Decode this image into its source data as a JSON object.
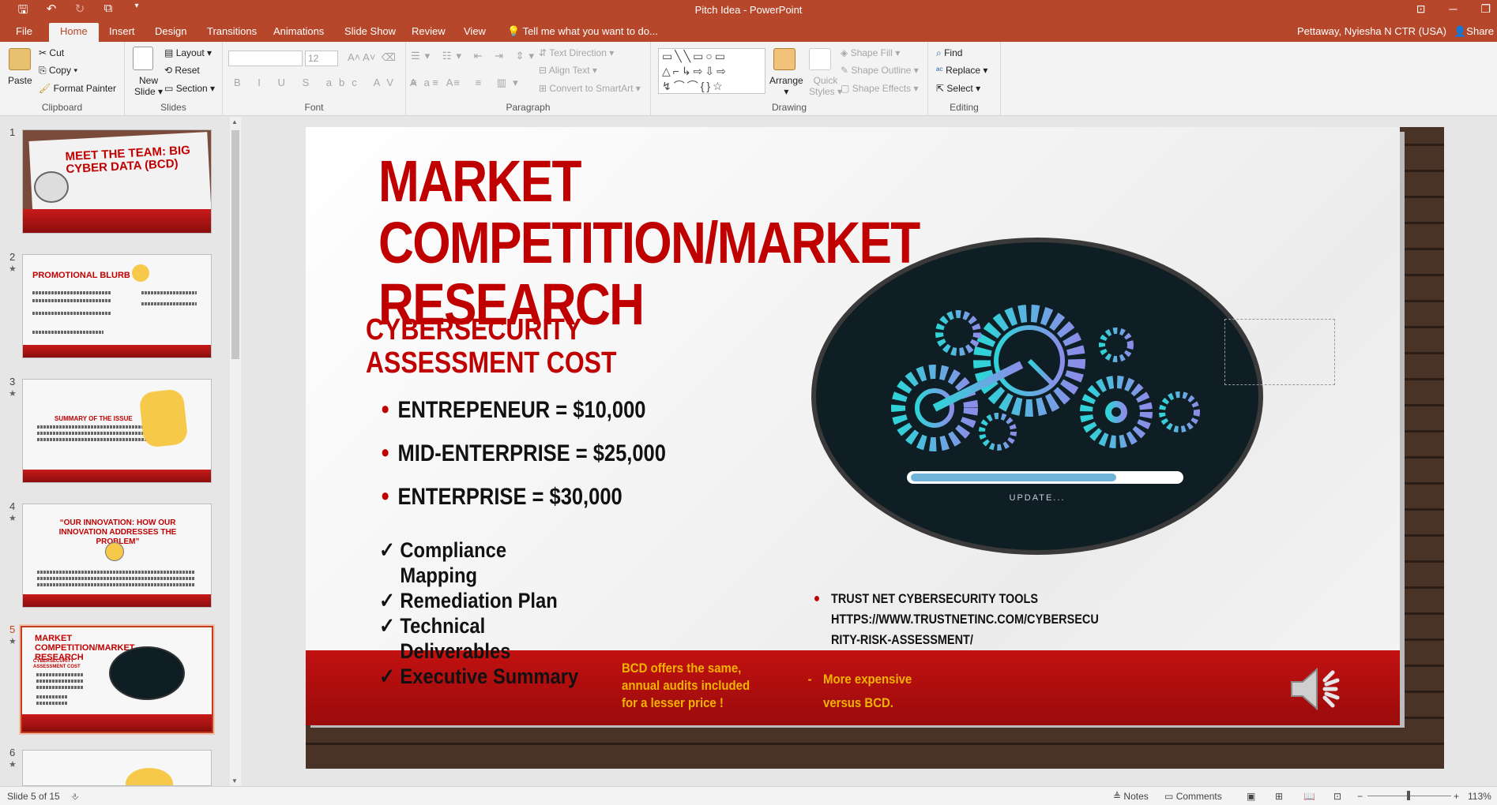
{
  "app": {
    "window_title": "Pitch Idea - PowerPoint",
    "tell_me": "Tell me what you want to do...",
    "user": "Pettaway, Nyiesha N CTR (USA)",
    "share": "Share"
  },
  "tabs": [
    "File",
    "Home",
    "Insert",
    "Design",
    "Transitions",
    "Animations",
    "Slide Show",
    "Review",
    "View"
  ],
  "ribbon": {
    "clipboard": {
      "paste": "Paste",
      "cut": "Cut",
      "copy": "Copy",
      "format_painter": "Format Painter",
      "label": "Clipboard"
    },
    "slides": {
      "new_slide_1": "New",
      "new_slide_2": "Slide",
      "layout": "Layout",
      "reset": "Reset",
      "section": "Section",
      "label": "Slides"
    },
    "font": {
      "size": "12",
      "label": "Font"
    },
    "paragraph": {
      "text_direction": "Text Direction",
      "align_text": "Align Text",
      "convert_smartart": "Convert to SmartArt",
      "label": "Paragraph"
    },
    "drawing": {
      "arrange": "Arrange",
      "quick_1": "Quick",
      "quick_2": "Styles",
      "shape_fill": "Shape Fill",
      "shape_outline": "Shape Outline",
      "shape_effects": "Shape Effects",
      "label": "Drawing"
    },
    "editing": {
      "find": "Find",
      "replace": "Replace",
      "select": "Select",
      "label": "Editing"
    }
  },
  "thumbnails": [
    {
      "num": "1",
      "title": "MEET THE TEAM: BIG CYBER DATA (BCD)"
    },
    {
      "num": "2",
      "title": "PROMOTIONAL BLURB"
    },
    {
      "num": "3",
      "title": "SUMMARY OF THE ISSUE"
    },
    {
      "num": "4",
      "title": "“OUR INNOVATION: HOW OUR INNOVATION ADDRESSES THE PROBLEM”"
    },
    {
      "num": "5",
      "title": "MARKET COMPETITION/MARKET RESEARCH"
    },
    {
      "num": "6",
      "title": ""
    }
  ],
  "slide": {
    "title": "MARKET COMPETITION/MARKET RESEARCH",
    "subhead": "CYBERSECURITY ASSESSMENT COST",
    "bullets": [
      "ENTREPENEUR = $10,000",
      "MID-ENTERPRISE = $25,000",
      "ENTERPRISE = $30,000"
    ],
    "checks": [
      "Compliance Mapping",
      "Remediation Plan",
      "Technical Deliverables",
      "Executive Summary"
    ],
    "image_caption": "UPDATE...",
    "trust_line1": "TRUST NET CYBERSECURITY TOOLS",
    "trust_line2": "HTTPS://WWW.TRUSTNETINC.COM/CYBERSECU",
    "trust_line3": "RITY-RISK-ASSESSMENT/",
    "bcd_note": "BCD offers the same, annual audits included for a lesser price !",
    "more_dash": "-",
    "more_line1": "More expensive",
    "more_line2": "versus BCD."
  },
  "status": {
    "slide_count": "Slide 5 of 15",
    "notes": "Notes",
    "comments": "Comments",
    "zoom": "113%"
  },
  "colors": {
    "accent": "#b7472a",
    "slide_red": "#c00000",
    "gold": "#f0b400",
    "gear": "#3ec6d8"
  }
}
